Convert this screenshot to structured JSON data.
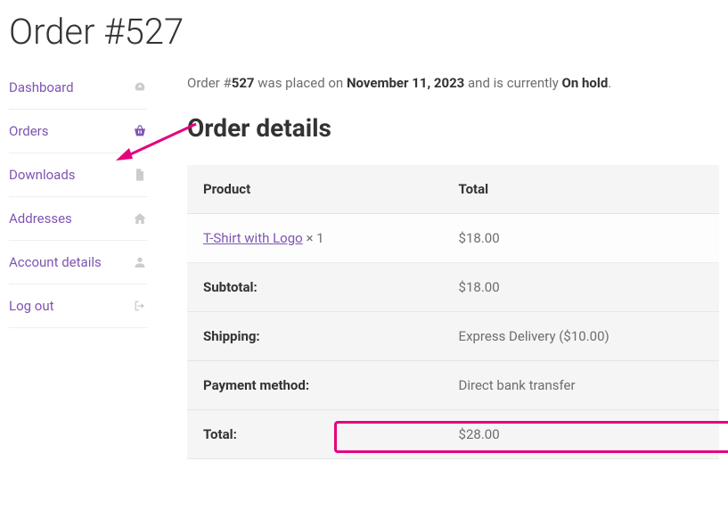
{
  "page_title": "Order #527",
  "sidebar": {
    "items": [
      {
        "label": "Dashboard"
      },
      {
        "label": "Orders"
      },
      {
        "label": "Downloads"
      },
      {
        "label": "Addresses"
      },
      {
        "label": "Account details"
      },
      {
        "label": "Log out"
      }
    ]
  },
  "status": {
    "prefix": "Order #",
    "order_num": "527",
    "mid1": " was placed on ",
    "date": "November 11, 2023",
    "mid2": " and is currently ",
    "state": "On hold",
    "suffix": "."
  },
  "section_title": "Order details",
  "table": {
    "head_product": "Product",
    "head_total": "Total",
    "product_name": "T-Shirt with Logo",
    "product_qty": " × 1",
    "product_price": "$18.00",
    "rows": [
      {
        "label": "Subtotal:",
        "value": "$18.00"
      },
      {
        "label": "Shipping:",
        "value": "Express Delivery ($10.00)"
      },
      {
        "label": "Payment method:",
        "value": "Direct bank transfer"
      },
      {
        "label": "Total:",
        "value": "$28.00"
      }
    ]
  }
}
